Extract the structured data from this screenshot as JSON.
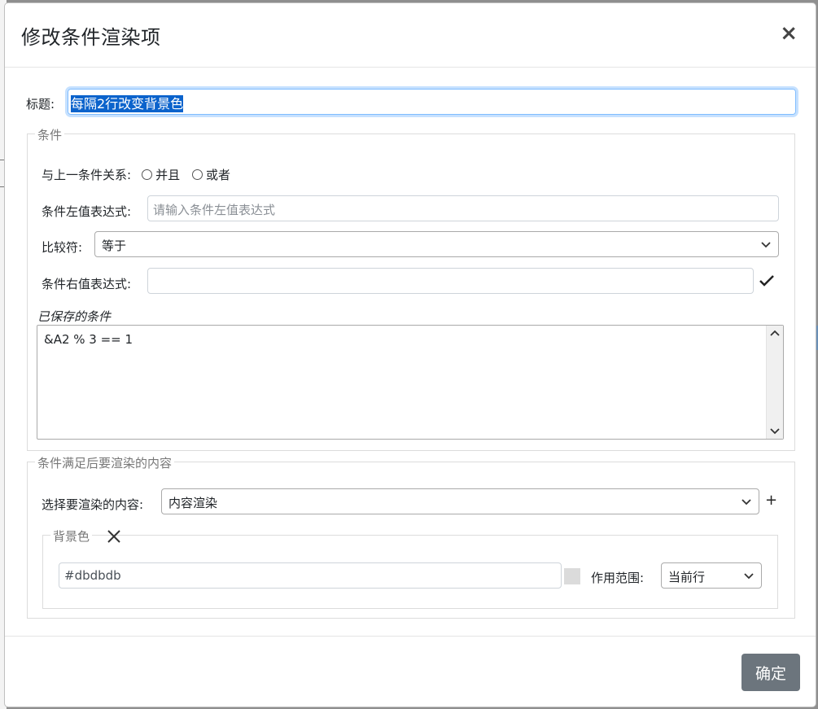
{
  "modal": {
    "title": "修改条件渲染项",
    "close_label": "×"
  },
  "title_field": {
    "label": "标题:",
    "value": "每隔2行改变背景色"
  },
  "condition": {
    "legend": "条件",
    "relation_label": "与上一条件关系:",
    "relation_options": [
      "并且",
      "或者"
    ],
    "left_expr_label": "条件左值表达式:",
    "left_expr_placeholder": "请输入条件左值表达式",
    "left_expr_value": "",
    "operator_label": "比较符:",
    "operator_value": "等于",
    "right_expr_label": "条件右值表达式:",
    "right_expr_value": "",
    "saved_label": "已保存的条件",
    "saved_conditions": [
      "&A2 % 3 == 1"
    ]
  },
  "render": {
    "legend": "条件满足后要渲染的内容",
    "select_label": "选择要渲染的内容:",
    "select_value": "内容渲染",
    "add_label": "+",
    "background": {
      "legend": "背景色",
      "color_value": "#dbdbdb",
      "scope_label": "作用范围:",
      "scope_value": "当前行"
    }
  },
  "footer": {
    "ok_label": "确定"
  },
  "icons": {
    "close": "close-icon",
    "check": "check-icon",
    "chevron": "chevron-down-icon",
    "remove": "x-icon",
    "plus": "plus-icon"
  }
}
